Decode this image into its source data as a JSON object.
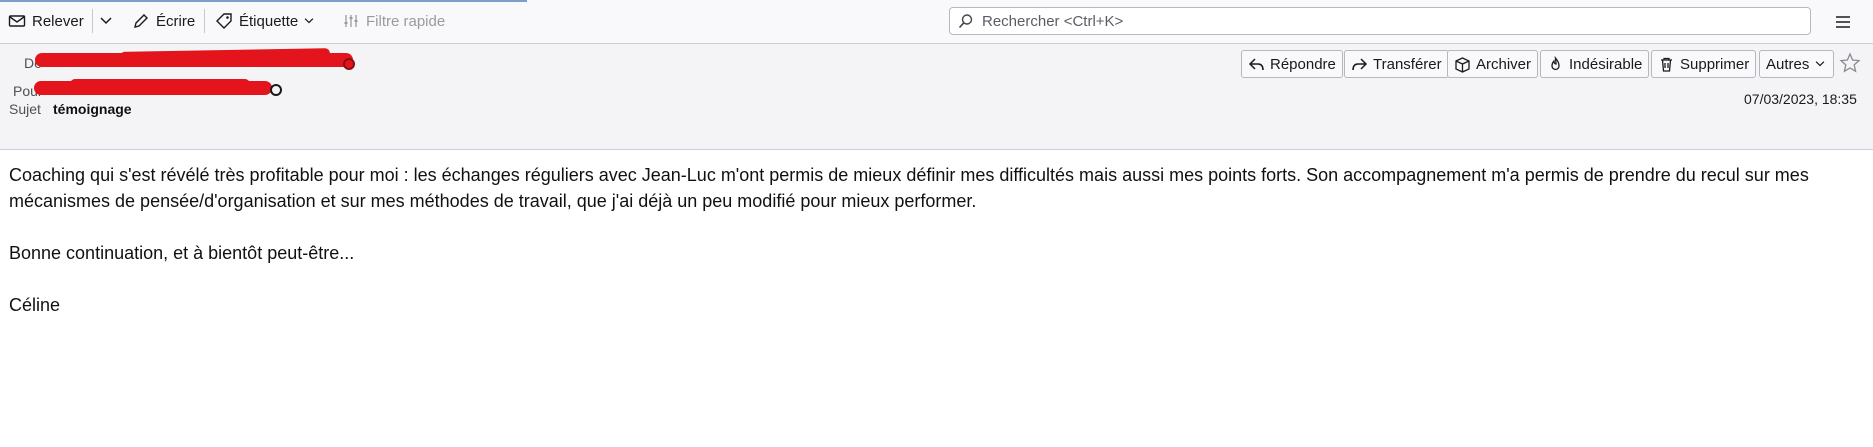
{
  "toolbar": {
    "get_messages": "Relever",
    "write": "Écrire",
    "tag": "Étiquette",
    "quick_filter": "Filtre rapide",
    "search_placeholder": "Rechercher <Ctrl+K>"
  },
  "header": {
    "from_label": "De",
    "to_label": "Pour",
    "subject_label": "Sujet",
    "subject": "témoignage",
    "date": "07/03/2023, 18:35",
    "actions": {
      "reply": "Répondre",
      "forward": "Transférer",
      "archive": "Archiver",
      "junk": "Indésirable",
      "delete": "Supprimer",
      "more": "Autres"
    }
  },
  "message": {
    "paragraph1": "Coaching qui s'est révélé très profitable pour moi : les échanges réguliers avec Jean-Luc m'ont permis de mieux définir mes difficultés mais aussi mes points forts. Son accompagnement m'a permis de prendre du recul sur mes mécanismes de pensée/d'organisation et sur mes méthodes de travail, que j'ai déjà un peu modifié pour mieux performer.",
    "paragraph2": "Bonne continuation, et à bientôt peut-être...",
    "signature": "Céline"
  },
  "colors": {
    "redaction": "#e3141c",
    "toolbar_bg": "#f9f9fb",
    "header_bg": "#f4f4f6"
  }
}
